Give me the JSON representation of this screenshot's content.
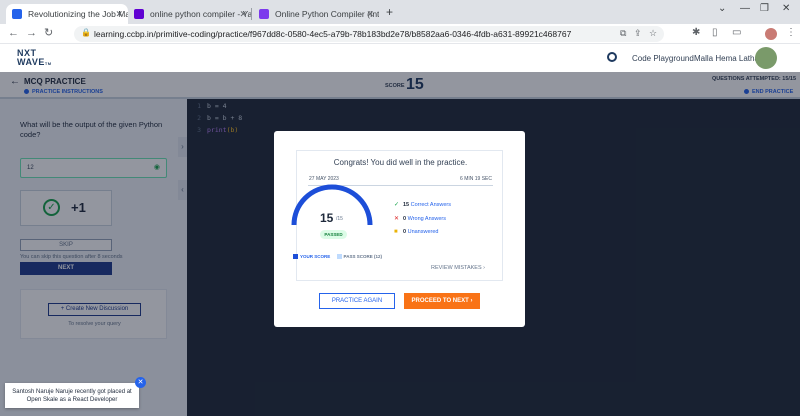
{
  "browser": {
    "tabs": [
      {
        "title": "Revolutionizing the Job Market |",
        "favicon_color": "#2563eb"
      },
      {
        "title": "online python compiler - Yahoo S",
        "favicon_color": "#6001d2"
      },
      {
        "title": "Online Python Compiler (Interpre",
        "favicon_color": "#7c3aed"
      }
    ],
    "new_tab_label": "+",
    "url": "learning.ccbp.in/primitive-coding/practice/f967dd8c-0580-4ec5-a79b-78b183bd2e78/b8582aa6-0346-4fdb-a631-89921c468767"
  },
  "header": {
    "logo_line1": "NXT",
    "logo_line2": "WAVE",
    "logo_sub": "TM",
    "playground": "Code Playground",
    "user_name": "Malla Hema Latha"
  },
  "practice": {
    "title": "MCQ PRACTICE",
    "instructions": "PRACTICE INSTRUCTIONS",
    "score_label": "SCORE",
    "score_value": "15",
    "attempted": "QUESTIONS ATTEMPTED: 15/15",
    "end": "END PRACTICE"
  },
  "question": {
    "text": "What will be the output of the given Python code?",
    "answer": "12",
    "points": "+1",
    "skip_label": "SKIP",
    "skip_note": "You can skip this question after 8 seconds",
    "next_label": "NEXT",
    "discussion_label": "+ Create New Discussion",
    "discussion_note": "To resolve your query"
  },
  "code": {
    "lines": [
      {
        "n": "1",
        "code": "b = 4"
      },
      {
        "n": "2",
        "code": "b = b + 8"
      },
      {
        "n": "3",
        "fn": "print",
        "arg": "(b)"
      }
    ]
  },
  "result": {
    "congrats": "Congrats! You did well in the practice.",
    "date": "27 MAY 2023",
    "duration": "6 MIN 19 SEC",
    "score": "15",
    "total": "/15",
    "status": "PASSED",
    "score_fraction": 1.0,
    "stats": [
      {
        "icon": "✓",
        "color": "#16a34a",
        "count": "15",
        "label": "Correct Answers"
      },
      {
        "icon": "✕",
        "color": "#dc2626",
        "count": "0",
        "label": "Wrong Answers"
      },
      {
        "icon": "■",
        "color": "#eab308",
        "count": "0",
        "label": "Unanswered"
      }
    ],
    "legend_your": "YOUR SCORE",
    "legend_pass": "PASS SCORE (12)",
    "review": "REVIEW MISTAKES",
    "practice_again": "PRACTICE AGAIN",
    "proceed": "PROCEED TO NEXT"
  },
  "toast": {
    "line1": "Santosh Naruje Naruje recently got placed at",
    "line2": "Open Skale as a React Developer"
  },
  "colors": {
    "accent": "#2563eb",
    "primary_dark": "#1e3a8a",
    "orange": "#f97316",
    "success": "#16a34a"
  }
}
